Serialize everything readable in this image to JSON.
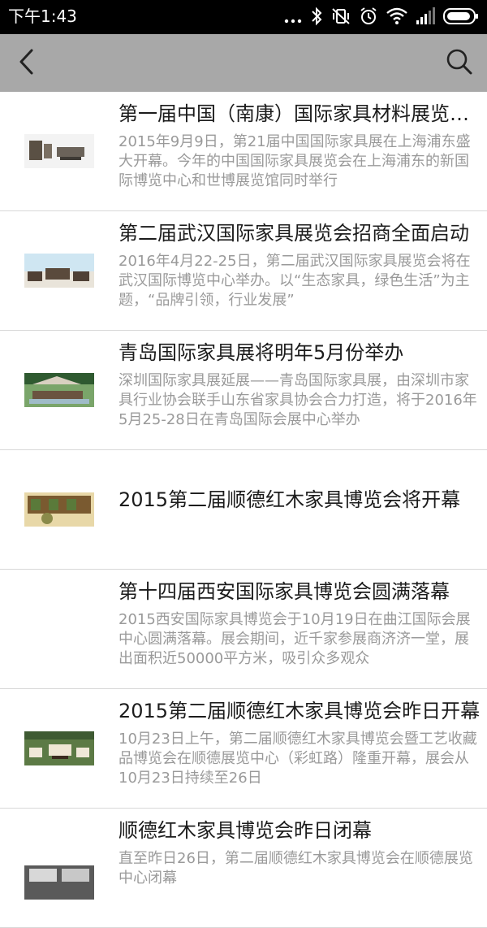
{
  "status_bar": {
    "time": "下午1:43",
    "icons": [
      "more-dots-icon",
      "bluetooth-icon",
      "vibrate-icon",
      "alarm-icon",
      "wifi-icon",
      "signal-icon",
      "battery-icon"
    ]
  },
  "app_bar": {
    "background": "#a8a8a8",
    "icons": [
      "back-arrow-icon",
      "search-icon"
    ]
  },
  "news_items": [
    {
      "title": "第一届中国（南康）国际家具材料展览会盛大开幕",
      "summary": "2015年9月9日，第21届中国国际家具展在上海浦东盛大开幕。今年的中国国际家具展览会在上海浦东的新国际博览中心和世博展览馆同时举行",
      "has_image": true
    },
    {
      "title": "第二届武汉国际家具展览会招商全面启动",
      "summary": "2016年4月22-25日，第二届武汉国际家具展览会将在武汉国际博览中心举办。以“生态家具，绿色生活”为主题，“品牌引领，行业发展”",
      "has_image": true
    },
    {
      "title": "青岛国际家具展将明年5月份举办",
      "summary": "深圳国际家具展延展——青岛国际家具展，由深圳市家具行业协会联手山东省家具协会合力打造，将于2016年5月25-28日在青岛国际会展中心举办",
      "has_image": true
    },
    {
      "title": "2015第二届顺德红木家具博览会将开幕",
      "summary": "",
      "has_image": true
    },
    {
      "title": "第十四届西安国际家具博览会圆满落幕",
      "summary": "2015西安国际家具博览会于10月19日在曲江国际会展中心圆满落幕。展会期间，近千家参展商济济一堂，展出面积近50000平方米，吸引众多观众",
      "has_image": false
    },
    {
      "title": "2015第二届顺德红木家具博览会昨日开幕",
      "summary": "10月23日上午，第二届顺德红木家具博览会暨工艺收藏品博览会在顺德展览中心（彩虹路）隆重开幕，展会从10月23日持续至26日",
      "has_image": true
    },
    {
      "title": "顺德红木家具博览会昨日闭幕",
      "summary": "直至昨日26日，第二届顺德红木家具博览会在顺德展览中心闭幕",
      "has_image": true
    }
  ]
}
